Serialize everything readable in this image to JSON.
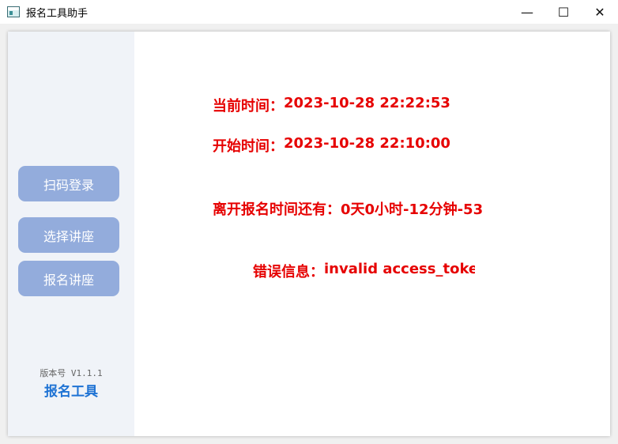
{
  "window": {
    "title": "报名工具助手",
    "controls": {
      "minimize": "—",
      "maximize": "☐",
      "close": "✕"
    }
  },
  "sidebar": {
    "buttons": [
      {
        "label": "扫码登录"
      },
      {
        "label": "选择讲座"
      },
      {
        "label": "报名讲座"
      }
    ],
    "version": "版本号 V1.1.1",
    "brand": "报名工具"
  },
  "main": {
    "current_time_label": "当前时间：",
    "current_time_value": "2023-10-28 22:22:53",
    "start_time_label": "开始时间：",
    "start_time_value": "2023-10-28 22:10:00",
    "countdown_label": "离开报名时间还有：",
    "countdown_value": " 0天0小时-12分钟-53",
    "error_label": "错误信息：",
    "error_value": "invalid access_token"
  },
  "colors": {
    "accent_text": "#e60000",
    "button_bg": "#93acdc",
    "brand": "#1f73d4",
    "sidebar_bg": "#f0f3f8"
  }
}
